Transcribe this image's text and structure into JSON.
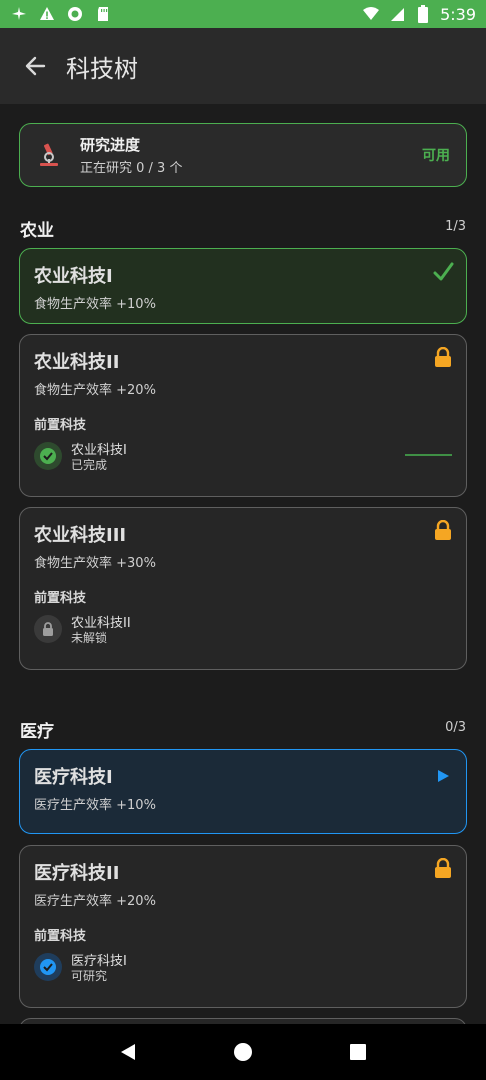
{
  "status_bar": {
    "time": "5:39",
    "icons": [
      "airplane-mode-icon",
      "warning-icon",
      "sync-icon",
      "sd-card-icon",
      "wifi-icon",
      "signal-icon",
      "battery-icon"
    ]
  },
  "app_bar": {
    "title": "科技树",
    "back_icon": "back-arrow-icon"
  },
  "research_progress": {
    "title": "研究进度",
    "subtitle": "正在研究 0 / 3 个",
    "status": "可用",
    "icon": "microscope-icon"
  },
  "sections": [
    {
      "title": "农业",
      "count": "1/3",
      "techs": [
        {
          "name": "农业科技I",
          "desc": "食物生产效率 +10%",
          "state": "completed",
          "icon": "checkmark-icon"
        },
        {
          "name": "农业科技II",
          "desc": "食物生产效率 +20%",
          "state": "locked",
          "icon": "lock-icon",
          "prereq_label": "前置科技",
          "prereq": {
            "name": "农业科技I",
            "state": "已完成",
            "icon": "check-circle-icon"
          }
        },
        {
          "name": "农业科技III",
          "desc": "食物生产效率 +30%",
          "state": "locked",
          "icon": "lock-icon",
          "prereq_label": "前置科技",
          "prereq": {
            "name": "农业科技II",
            "state": "未解锁",
            "icon": "lock-icon"
          }
        }
      ]
    },
    {
      "title": "医疗",
      "count": "0/3",
      "techs": [
        {
          "name": "医疗科技I",
          "desc": "医疗生产效率 +10%",
          "state": "available",
          "icon": "play-icon"
        },
        {
          "name": "医疗科技II",
          "desc": "医疗生产效率 +20%",
          "state": "locked",
          "icon": "lock-icon",
          "prereq_label": "前置科技",
          "prereq": {
            "name": "医疗科技I",
            "state": "可研究",
            "icon": "check-circle-icon"
          }
        }
      ]
    }
  ],
  "colors": {
    "accent_green": "#4caf50",
    "accent_blue": "#2196f3",
    "lock_orange": "#f5a623"
  }
}
